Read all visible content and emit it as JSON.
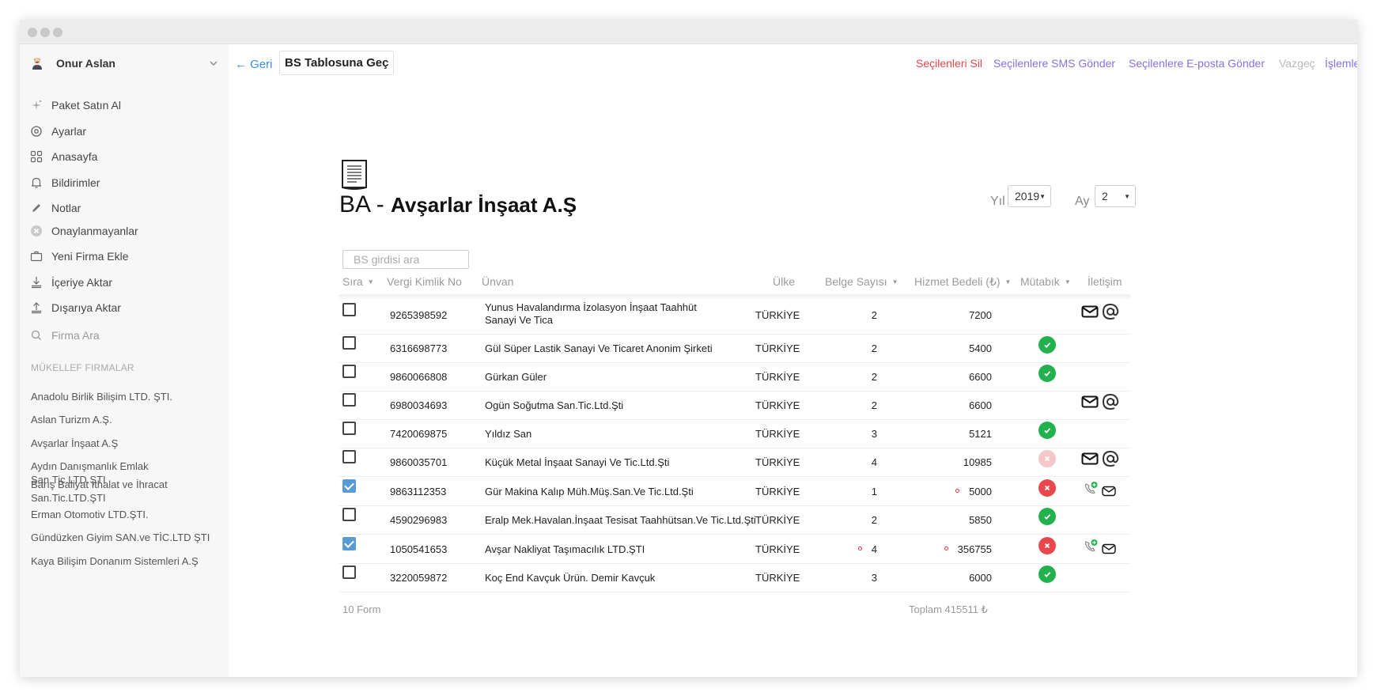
{
  "user": {
    "name": "Onur Aslan"
  },
  "nav": [
    {
      "label": "Paket Satın Al",
      "icon": "sparkle-icon"
    },
    {
      "label": "Ayarlar",
      "icon": "gear-icon"
    },
    {
      "label": "Anasayfa",
      "icon": "grid-icon"
    },
    {
      "label": "Bildirimler",
      "icon": "bell-icon"
    },
    {
      "label": "Notlar",
      "icon": "pencil-icon"
    },
    {
      "label": "Onaylanmayanlar",
      "icon": "x-circle-icon"
    },
    {
      "label": "Yeni Firma Ekle",
      "icon": "briefcase-icon"
    },
    {
      "label": "İçeriye Aktar",
      "icon": "import-icon"
    },
    {
      "label": "Dışarıya Aktar",
      "icon": "export-icon"
    }
  ],
  "firm_search": {
    "placeholder": "Firma Ara"
  },
  "firms_section_title": "MÜKELLEF FIRMALAR",
  "firms": [
    "Anadolu Birlik Bilişim LTD. ŞTI.",
    "Aslan Turizm A.Ş.",
    "Avşarlar İnşaat A.Ş",
    "Aydın Danışmanlık Emlak San.Tic.LTD.ŞTI",
    "Barış Baliyat İthalat ve İhracat San.Tic.LTD.ŞTI",
    "Erman Otomotiv LTD.ŞTI.",
    "Gündüzken Giyim SAN.ve TİC.LTD ŞTI",
    "Kaya Bilişim Donanım Sistemleri A.Ş"
  ],
  "toolbar": {
    "back": "← Geri",
    "bs_button": "BS Tablosuna Geç",
    "delete_selected": "Seçilenleri Sil",
    "send_sms": "Seçilenlere SMS Gönder",
    "send_email": "Seçilenlere E-posta Gönder",
    "cancel": "Vazgeç",
    "operations": "İşlemler"
  },
  "colors": {
    "danger": "#e8474c",
    "purple": "#8a6fe8",
    "link": "#3a8ee6",
    "ok": "#22b14c",
    "pending": "#f7c57a"
  },
  "title": {
    "prefix": "BA -",
    "firm": "Avşarlar İnşaat A.Ş"
  },
  "filters": {
    "year_label": "Yıl",
    "year_value": "2019",
    "month_label": "Ay",
    "month_value": "2"
  },
  "table_search": {
    "placeholder": "BS girdisi ara"
  },
  "columns": [
    "Sıra",
    "Vergi Kimlik No",
    "Ünvan",
    "Ülke",
    "Belge Sayısı",
    "Hizmet Bedeli (₺)",
    "Mütabık",
    "İletişim"
  ],
  "rows": [
    {
      "checked": false,
      "vkn": "9265398592",
      "unvan": "Yunus Havalandırma İzolasyon İnşaat Taahhüt Sanayi Ve",
      "unvan2": "Tica",
      "ulke": "TÜRKİYE",
      "belge": "2",
      "bedel": "7200",
      "status": "pending",
      "contact": "mail-at",
      "belge_flag": false,
      "bedel_flag": false
    },
    {
      "checked": false,
      "vkn": "6316698773",
      "unvan": "Gül Süper Lastik Sanayi Ve Ticaret Anonim Şirketi",
      "unvan2": "",
      "ulke": "TÜRKİYE",
      "belge": "2",
      "bedel": "5400",
      "status": "ok",
      "contact": "none",
      "belge_flag": false,
      "bedel_flag": false
    },
    {
      "checked": false,
      "vkn": "9860066808",
      "unvan": "Gürkan Güler",
      "unvan2": "",
      "ulke": "TÜRKİYE",
      "belge": "2",
      "bedel": "6600",
      "status": "ok",
      "contact": "none",
      "belge_flag": false,
      "bedel_flag": false
    },
    {
      "checked": false,
      "vkn": "6980034693",
      "unvan": "Ogün Soğutma San.Tic.Ltd.Şti",
      "unvan2": "",
      "ulke": "TÜRKİYE",
      "belge": "2",
      "bedel": "6600",
      "status": "pending",
      "contact": "mail-at",
      "belge_flag": false,
      "bedel_flag": false
    },
    {
      "checked": false,
      "vkn": "7420069875",
      "unvan": "Yıldız San",
      "unvan2": "",
      "ulke": "TÜRKİYE",
      "belge": "3",
      "bedel": "5121",
      "status": "ok",
      "contact": "none",
      "belge_flag": false,
      "bedel_flag": false
    },
    {
      "checked": false,
      "vkn": "9860035701",
      "unvan": "Küçük Metal İnşaat Sanayi Ve Tic.Ltd.Şti",
      "unvan2": "",
      "ulke": "TÜRKİYE",
      "belge": "4",
      "bedel": "10985",
      "status": "faint",
      "contact": "mail-at",
      "belge_flag": false,
      "bedel_flag": false
    },
    {
      "checked": true,
      "vkn": "9863112353",
      "unvan": "Gür Makina Kalıp Müh.Müş.San.Ve Tic.Ltd.Şti",
      "unvan2": "",
      "ulke": "TÜRKİYE",
      "belge": "1",
      "bedel": "5000",
      "status": "fail",
      "contact": "phone-mail",
      "belge_flag": false,
      "bedel_flag": true
    },
    {
      "checked": false,
      "vkn": "4590296983",
      "unvan": "Eralp Mek.Havalan.İnşaat Tesisat Taahhütsan.Ve Tic.Ltd.Şti",
      "unvan2": "",
      "ulke": "TÜRKİYE",
      "belge": "2",
      "bedel": "5850",
      "status": "ok",
      "contact": "none",
      "belge_flag": false,
      "bedel_flag": false
    },
    {
      "checked": true,
      "vkn": "1050541653",
      "unvan": "Avşar Nakliyat Taşımacılık LTD.ŞTI",
      "unvan2": "",
      "ulke": "TÜRKİYE",
      "belge": "4",
      "bedel": "356755",
      "status": "fail",
      "contact": "phone-mail",
      "belge_flag": true,
      "bedel_flag": true
    },
    {
      "checked": false,
      "vkn": "3220059872",
      "unvan": "Koç End Kavçuk Ürün. Demir Kavçuk",
      "unvan2": "",
      "ulke": "TÜRKİYE",
      "belge": "3",
      "bedel": "6000",
      "status": "ok",
      "contact": "none",
      "belge_flag": false,
      "bedel_flag": false
    }
  ],
  "footer": {
    "count": "10 Form",
    "total": "Toplam 415511 ₺"
  }
}
